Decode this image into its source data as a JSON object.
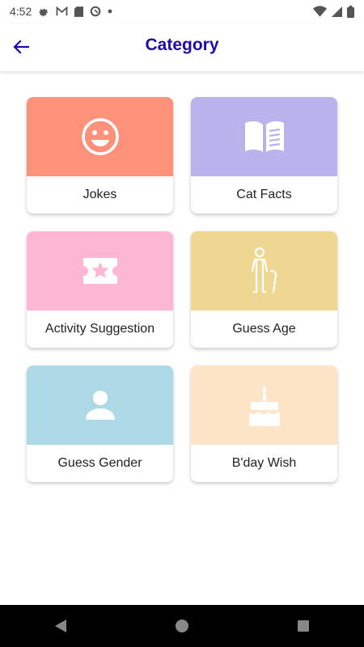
{
  "status_bar": {
    "time": "4:52"
  },
  "header": {
    "title": "Category",
    "title_color": "#1e0aa8"
  },
  "categories": [
    {
      "label": "Jokes",
      "icon": "smiley-face-icon",
      "color": "#fe9179"
    },
    {
      "label": "Cat Facts",
      "icon": "open-book-icon",
      "color": "#b9b2eb"
    },
    {
      "label": "Activity Suggestion",
      "icon": "ticket-star-icon",
      "color": "#feb6d5"
    },
    {
      "label": "Guess Age",
      "icon": "elderly-person-icon",
      "color": "#f0d791"
    },
    {
      "label": "Guess Gender",
      "icon": "person-icon",
      "color": "#add8e6"
    },
    {
      "label": "B'day Wish",
      "icon": "birthday-cake-icon",
      "color": "#fee4c6"
    }
  ],
  "nav_bar": {
    "back": "back-triangle-icon",
    "home": "home-circle-icon",
    "recents": "recents-square-icon"
  }
}
